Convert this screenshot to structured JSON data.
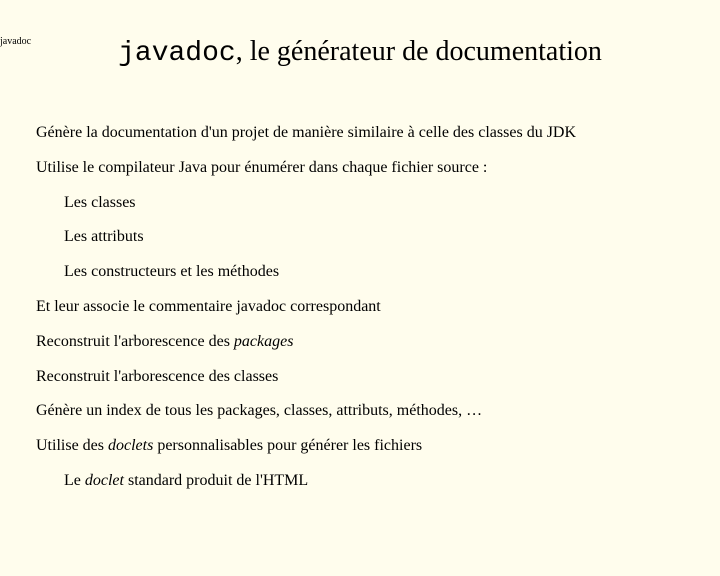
{
  "topLabel": "javadoc",
  "title": {
    "mono": "javadoc",
    "rest": ", le générateur de documentation"
  },
  "lines": {
    "p1": "Génère la documentation d'un projet de manière similaire à celle des classes du JDK",
    "p2": "Utilise le compilateur Java pour énumérer dans chaque fichier source :",
    "p3": "Les classes",
    "p4": "Les attributs",
    "p5": "Les constructeurs et les méthodes",
    "p6": "Et leur associe le commentaire javadoc correspondant",
    "p7a": "Reconstruit l'arborescence des ",
    "p7b": "packages",
    "p8": "Reconstruit l'arborescence des classes",
    "p9": "Génère un index de tous les packages, classes, attributs, méthodes, …",
    "p10a": "Utilise des ",
    "p10b": "doclets",
    "p10c": " personnalisables pour générer les fichiers",
    "p11a": "Le ",
    "p11b": "doclet",
    "p11c": " standard produit de l'HTML"
  }
}
